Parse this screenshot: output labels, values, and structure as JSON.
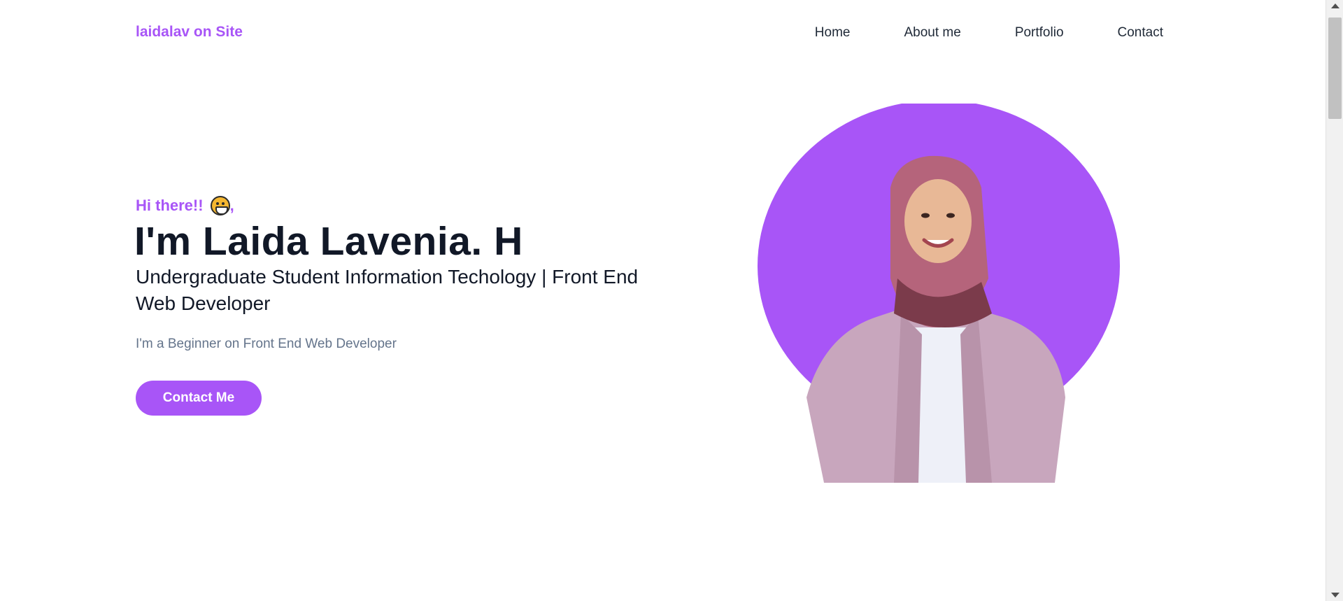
{
  "header": {
    "logo": "laidalav on Site",
    "nav": [
      {
        "label": "Home"
      },
      {
        "label": "About me"
      },
      {
        "label": "Portfolio"
      },
      {
        "label": "Contact"
      }
    ]
  },
  "hero": {
    "greeting": "Hi there!!",
    "greeting_emoji": "grinning-face-icon",
    "greeting_suffix": ",",
    "name": "I'm Laida Lavenia. H",
    "role": "Undergraduate Student Information Techology | Front End Web Developer",
    "tagline": "I'm a Beginner on Front End Web Developer",
    "cta_label": "Contact Me"
  },
  "colors": {
    "accent": "#a855f7",
    "text_dark": "#111827",
    "text_muted": "#64748b"
  }
}
